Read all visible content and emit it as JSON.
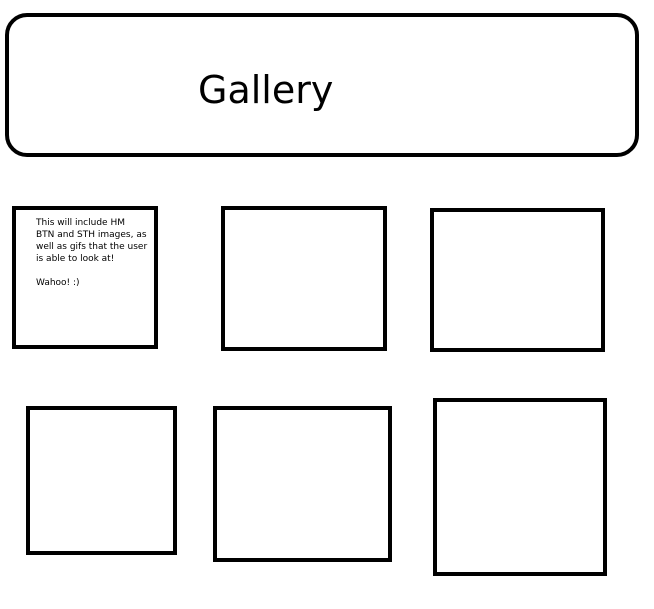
{
  "header": {
    "title": "Gallery"
  },
  "gallery": {
    "first_frame_note": {
      "lines": [
        "This will include HM",
        "BTN and STH images, as",
        "well as gifs that the user",
        "is able to look at!"
      ],
      "signoff": "Wahoo! :)"
    }
  }
}
